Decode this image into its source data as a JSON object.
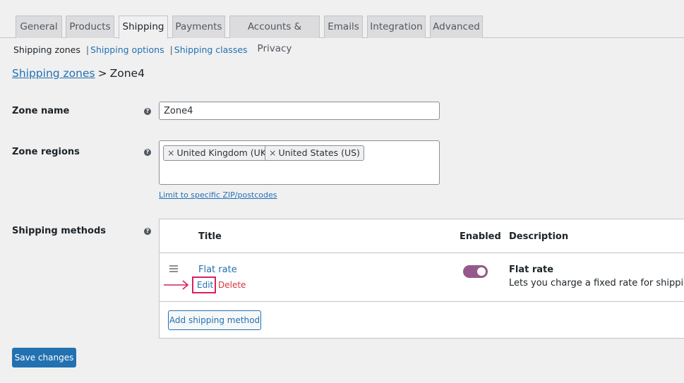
{
  "tabs": [
    {
      "label": "General"
    },
    {
      "label": "Products"
    },
    {
      "label": "Shipping",
      "active": true
    },
    {
      "label": "Payments"
    },
    {
      "label": "Accounts & Privacy"
    },
    {
      "label": "Emails"
    },
    {
      "label": "Integration"
    },
    {
      "label": "Advanced"
    }
  ],
  "subnav": {
    "current": "Shipping zones",
    "options": "Shipping options",
    "classes": "Shipping classes",
    "separator": "|"
  },
  "breadcrumb": {
    "link": "Shipping zones",
    "separator": ">",
    "current": "Zone4"
  },
  "fields": {
    "zone_name_label": "Zone name",
    "zone_name_value": "Zone4",
    "zone_regions_label": "Zone regions",
    "regions": [
      "United Kingdom (UK)",
      "United States (US)"
    ],
    "remove_glyph": "×",
    "limit_link": "Limit to specific ZIP/postcodes",
    "shipping_methods_label": "Shipping methods",
    "help_glyph": "?"
  },
  "methods_table": {
    "headers": {
      "title": "Title",
      "enabled": "Enabled",
      "description": "Description"
    },
    "rows": [
      {
        "title": "Flat rate",
        "edit": "Edit",
        "delete": "Delete",
        "enabled": true,
        "description_title": "Flat rate",
        "description": "Lets you charge a fixed rate for shipping."
      }
    ],
    "add_button": "Add shipping method"
  },
  "save_button": "Save changes",
  "colors": {
    "link": "#2271b1",
    "toggle_on": "#96588a",
    "delete": "#d63638",
    "highlight": "#d6225a",
    "primary_button": "#2271b1"
  }
}
